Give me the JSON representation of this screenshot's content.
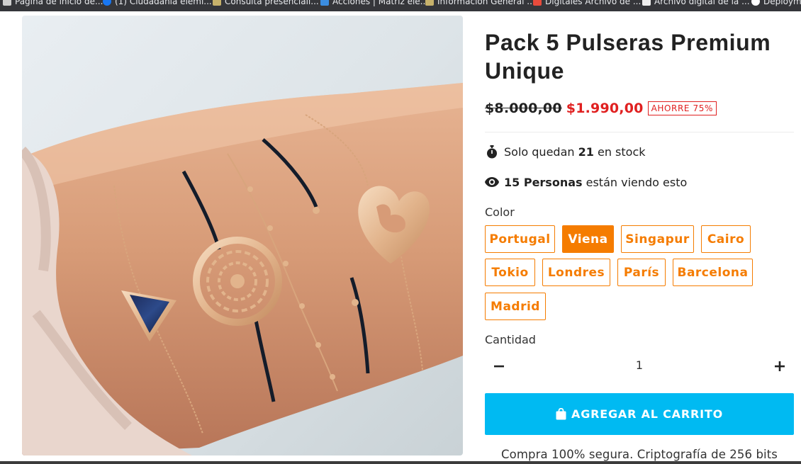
{
  "bookmarks": [
    {
      "label": "Página de inicio de...",
      "icon": "page-icon",
      "color": "#cfcfcf"
    },
    {
      "label": "(1) Ciudadanía elemi...",
      "icon": "facebook-icon",
      "color": "#1877f2"
    },
    {
      "label": "Consulta presenciali...",
      "icon": "shield-icon",
      "color": "#c7b26b"
    },
    {
      "label": "Acciones | Matriz ele...",
      "icon": "cloud-icon",
      "color": "#3b8de0"
    },
    {
      "label": "Información General ...",
      "icon": "shield-icon",
      "color": "#c7b26b"
    },
    {
      "label": "Digitales Archivo de ...",
      "icon": "doc-icon",
      "color": "#e84b3c"
    },
    {
      "label": "Archivo digital de la ...",
      "icon": "doc-icon",
      "color": "#eeeeee"
    },
    {
      "label": "Deploym",
      "icon": "github-icon",
      "color": "#ffffff"
    }
  ],
  "product": {
    "title": "Pack 5 Pulseras Premium Unique",
    "old_price": "$8.000,00",
    "price": "$1.990,00",
    "savings_badge": "AHORRE 75%",
    "image_icon": "bracelets-photo"
  },
  "stock": {
    "prefix": "Solo quedan",
    "count": "21",
    "suffix": "en stock",
    "icon": "stopwatch-icon"
  },
  "viewers": {
    "count_label": "15 Personas",
    "suffix": "están viendo esto",
    "icon": "eye-icon"
  },
  "color_option": {
    "label": "Color",
    "selected": "Viena",
    "options": [
      "Portugal",
      "Viena",
      "Singapur",
      "Cairo",
      "Tokio",
      "Londres",
      "París",
      "Barcelona",
      "Madrid"
    ]
  },
  "quantity": {
    "label": "Cantidad",
    "value": "1",
    "minus_icon": "minus-icon",
    "plus_icon": "plus-icon"
  },
  "cart": {
    "button_label": "AGREGAR AL CARRITO",
    "icon": "shopping-bag-icon"
  },
  "secure_text": "Compra 100% segura. Criptografía de 256 bits",
  "colors": {
    "accent_orange": "#f57c00",
    "price_red": "#e02020",
    "cart_blue": "#00baf2"
  }
}
